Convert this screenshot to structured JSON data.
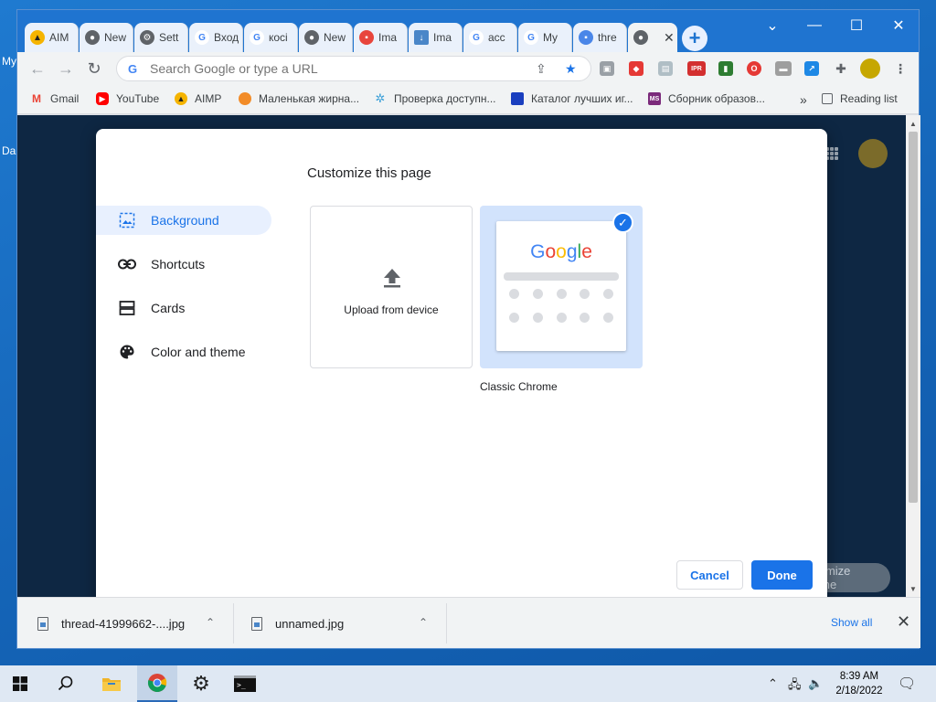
{
  "desktop": {
    "label_1": "My",
    "label_2": "Da"
  },
  "tabs": [
    {
      "label": "AIM",
      "icon": "aimp-icon",
      "color": "#f5b400"
    },
    {
      "label": "New",
      "icon": "chrome-icon",
      "color": "#5f6368"
    },
    {
      "label": "Sett",
      "icon": "gear-icon",
      "color": "#5f6368"
    },
    {
      "label": "Вход",
      "icon": "google-icon",
      "color": "#4285f4"
    },
    {
      "label": "косі",
      "icon": "google-icon",
      "color": "#4285f4"
    },
    {
      "label": "New",
      "icon": "chrome-icon",
      "color": "#5f6368"
    },
    {
      "label": "Ima",
      "icon": "image-icon",
      "color": "#e8453c"
    },
    {
      "label": "Ima",
      "icon": "download-icon",
      "color": "#4a86c8"
    },
    {
      "label": "acc",
      "icon": "google-icon",
      "color": "#4285f4"
    },
    {
      "label": "My",
      "icon": "google-icon",
      "color": "#4285f4"
    },
    {
      "label": "thre",
      "icon": "thread-icon",
      "color": "#4a86e8"
    },
    {
      "label": "",
      "icon": "chrome-icon",
      "color": "#5f6368"
    }
  ],
  "window_controls": {
    "minimize": "—",
    "maximize": "☐",
    "close": "✕",
    "tab_list": "⌄"
  },
  "omnibox": {
    "placeholder": "Search Google or type a URL"
  },
  "bookmarks": [
    {
      "label": "Gmail",
      "icon": "gmail-icon",
      "color": "#ea4335"
    },
    {
      "label": "YouTube",
      "icon": "youtube-icon",
      "color": "#ff0000"
    },
    {
      "label": "AIMP",
      "icon": "aimp-icon",
      "color": "#f5b400"
    },
    {
      "label": "Маленькая жирна...",
      "icon": "fox-icon",
      "color": "#f28c28"
    },
    {
      "label": "Проверка доступн...",
      "icon": "gear-icon",
      "color": "#3ca0d8"
    },
    {
      "label": "Каталог лучших иг...",
      "icon": "flag-icon",
      "color": "#1a3fbf"
    },
    {
      "label": "Сборник образов...",
      "icon": "ms-icon",
      "color": "#7b2a7b"
    }
  ],
  "bookmarks_overflow": "»",
  "reading_list": "Reading list",
  "ntp": {
    "customize_button": "Customize Chrome"
  },
  "dialog": {
    "title": "Customize this page",
    "nav": [
      {
        "label": "Background",
        "icon": "image-icon"
      },
      {
        "label": "Shortcuts",
        "icon": "link-icon"
      },
      {
        "label": "Cards",
        "icon": "cards-icon"
      },
      {
        "label": "Color and theme",
        "icon": "palette-icon"
      }
    ],
    "upload_label": "Upload from device",
    "classic_label": "Classic Chrome",
    "cancel": "Cancel",
    "done": "Done",
    "accent": "#1a73e8"
  },
  "downloads": [
    {
      "name": "thread-41999662-....jpg"
    },
    {
      "name": "unnamed.jpg"
    }
  ],
  "downloads_show_all": "Show all",
  "taskbar": {
    "time": "8:39 AM",
    "date": "2/18/2022"
  }
}
